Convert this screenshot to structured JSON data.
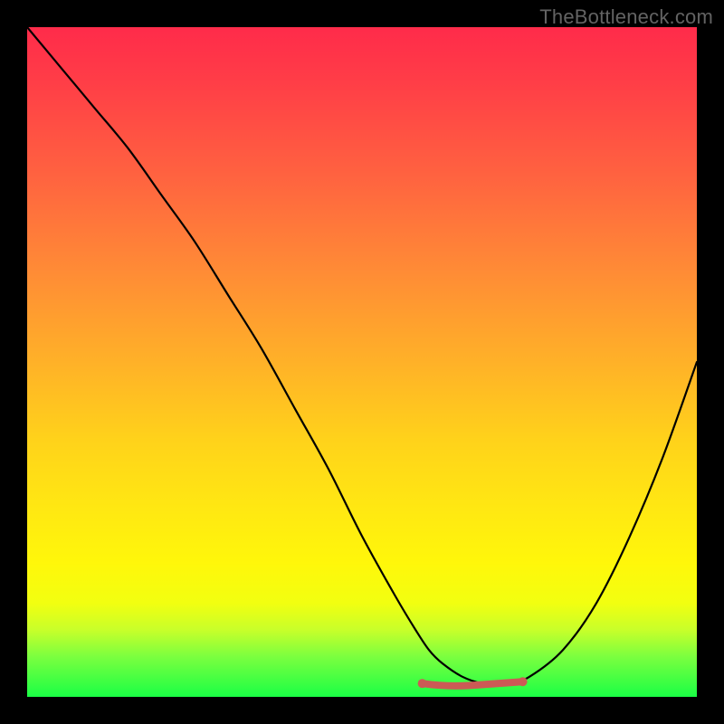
{
  "watermark": "TheBottleneck.com",
  "colors": {
    "background": "#000000",
    "gradient_top": "#ff2b4a",
    "gradient_bottom": "#1aff45",
    "curve": "#000000",
    "tolerance": "#cc5a55"
  },
  "chart_data": {
    "type": "line",
    "title": "",
    "xlabel": "",
    "ylabel": "",
    "xlim": [
      0,
      100
    ],
    "ylim": [
      0,
      100
    ],
    "series": [
      {
        "name": "bottleneck-curve",
        "x": [
          0,
          5,
          10,
          15,
          20,
          25,
          30,
          35,
          40,
          45,
          50,
          55,
          58,
          60,
          62,
          65,
          68,
          70,
          72,
          75,
          80,
          85,
          90,
          95,
          100
        ],
        "values": [
          100,
          94,
          88,
          82,
          75,
          68,
          60,
          52,
          43,
          34,
          24,
          15,
          10,
          7,
          5,
          3,
          2,
          2,
          2,
          3,
          7,
          14,
          24,
          36,
          50
        ]
      }
    ],
    "annotations": [
      {
        "name": "optimal-range",
        "x_start": 59,
        "x_end": 74,
        "y": 2
      }
    ]
  }
}
